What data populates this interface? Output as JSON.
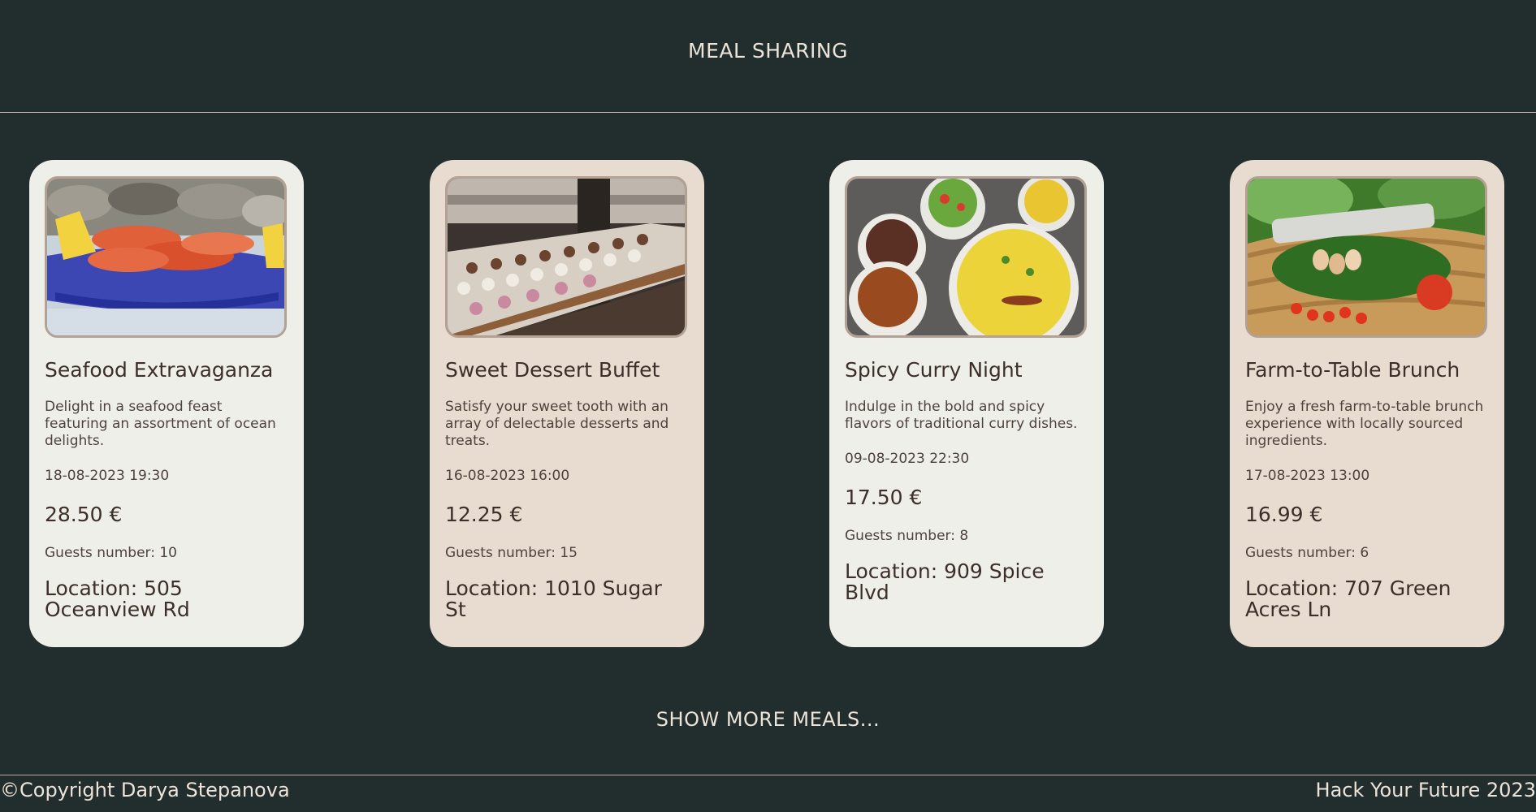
{
  "header": {
    "title": "MEAL SHARING"
  },
  "meals": [
    {
      "title": "Seafood Extravaganza",
      "description": "Delight in a seafood feast featuring an assortment of ocean delights.",
      "date": "18-08-2023 19:30",
      "price": "28.50 €",
      "guests": "Guests number: 10",
      "location": "Location: 505 Oceanview Rd",
      "image": "seafood-photo"
    },
    {
      "title": "Sweet Dessert Buffet",
      "description": "Satisfy your sweet tooth with an array of delectable desserts and treats.",
      "date": "16-08-2023 16:00",
      "price": "12.25 €",
      "guests": "Guests number: 15",
      "location": "Location: 1010 Sugar St",
      "image": "dessert-buffet-photo"
    },
    {
      "title": "Spicy Curry Night",
      "description": "Indulge in the bold and spicy flavors of traditional curry dishes.",
      "date": "09-08-2023 22:30",
      "price": "17.50 €",
      "guests": "Guests number: 8",
      "location": "Location: 909 Spice Blvd",
      "image": "curry-photo"
    },
    {
      "title": "Farm-to-Table Brunch",
      "description": "Enjoy a fresh farm-to-table brunch experience with locally sourced ingredients.",
      "date": "17-08-2023 13:00",
      "price": "16.99 €",
      "guests": "Guests number: 6",
      "location": "Location: 707 Green Acres Ln",
      "image": "farm-basket-photo"
    }
  ],
  "show_more": {
    "label": "SHOW MORE MEALS..."
  },
  "footer": {
    "copyright": "©Copyright Darya Stepanova",
    "right_text": "Hack Your Future 2023"
  },
  "colors": {
    "background": "#222e2e",
    "card_light": "#efefe9",
    "card_tan": "#e8dbcf",
    "header_text": "#ece3d9",
    "card_text": "#3c2f2a"
  }
}
